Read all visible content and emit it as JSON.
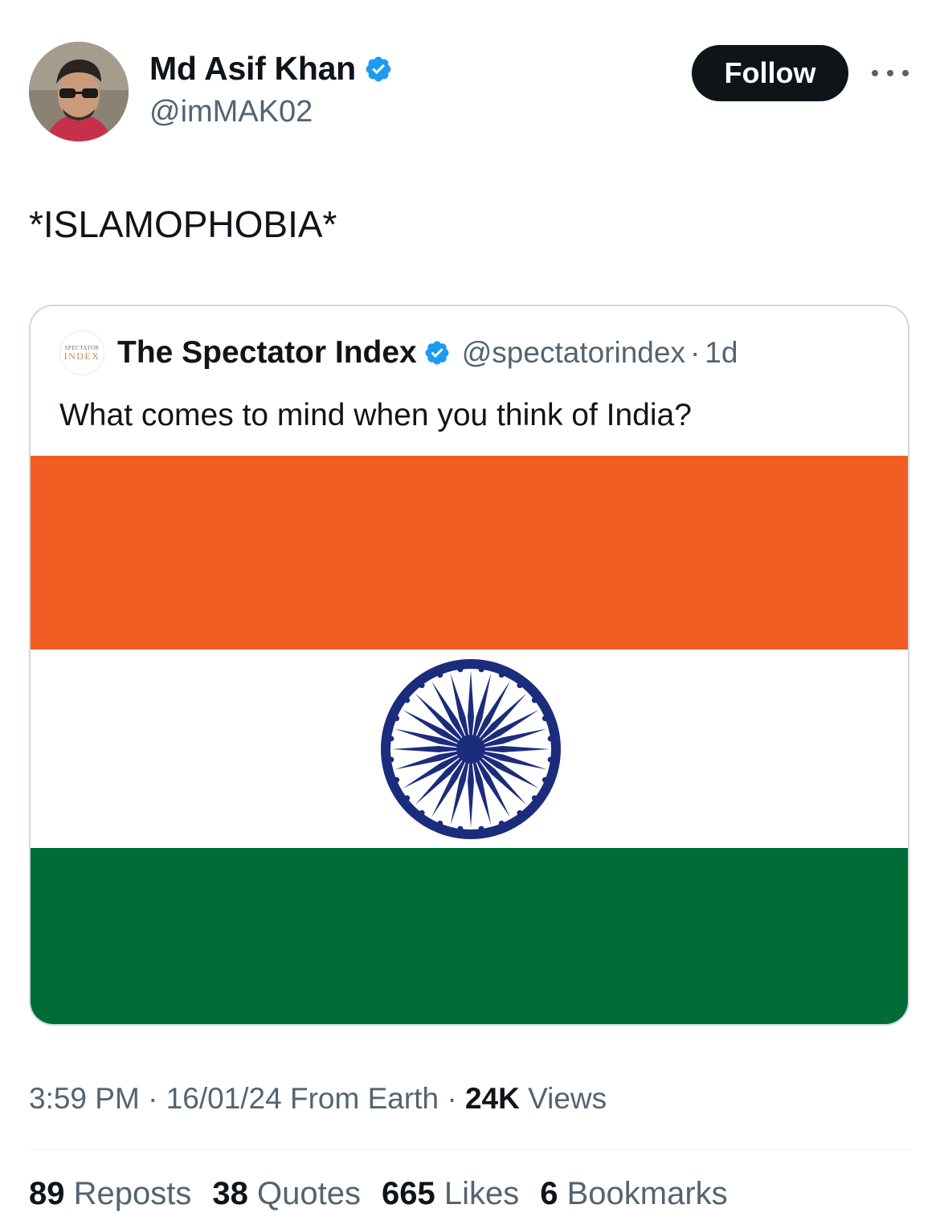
{
  "author": {
    "display_name": "Md Asif Khan",
    "handle": "@imMAK02",
    "verified": true
  },
  "actions": {
    "follow_label": "Follow"
  },
  "tweet": {
    "text": "*ISLAMOPHOBIA*"
  },
  "quoted_tweet": {
    "logo_top": "SPECTATOR",
    "logo_bottom": "INDEX",
    "display_name": "The Spectator Index",
    "handle": "@spectatorindex",
    "separator": "·",
    "time": "1d",
    "text": "What comes to mind when you think of India?",
    "image": {
      "subject": "indian-flag",
      "colors": {
        "saffron": "#f15d22",
        "white": "#ffffff",
        "green": "#006c35",
        "chakra": "#1c2c7c"
      }
    }
  },
  "meta": {
    "time": "3:59 PM",
    "sep1": "·",
    "date": "16/01/24",
    "source": "From Earth",
    "sep2": "·",
    "views_count": "24K",
    "views_label": "Views"
  },
  "stats": [
    {
      "count": "89",
      "label": "Reposts"
    },
    {
      "count": "38",
      "label": "Quotes"
    },
    {
      "count": "665",
      "label": "Likes"
    },
    {
      "count": "6",
      "label": "Bookmarks"
    }
  ],
  "colors": {
    "verified_blue": "#1d9bf0",
    "follow_bg": "#0f1419",
    "secondary_text": "#536471"
  }
}
